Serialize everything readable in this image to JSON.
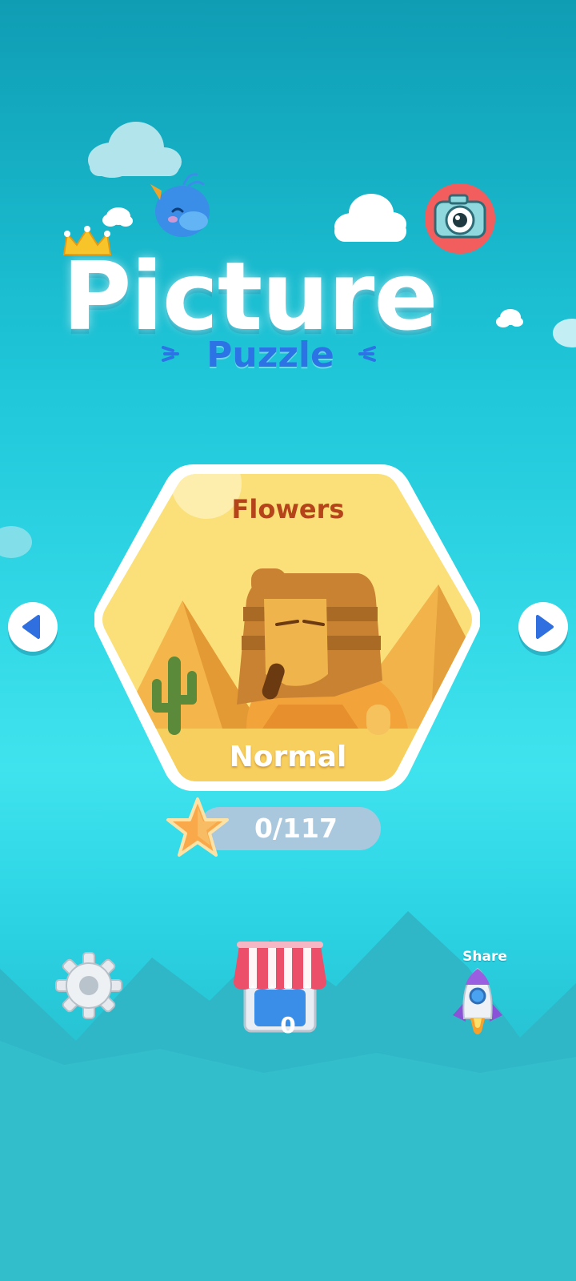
{
  "title": {
    "main": "Picture",
    "sub": "Puzzle"
  },
  "level_card": {
    "category": "Flowers",
    "difficulty": "Normal",
    "artwork": "sphinx-desert-illustration"
  },
  "progress": {
    "text": "0/117",
    "icon": "star-icon"
  },
  "navigation": {
    "prev_icon": "arrow-left-icon",
    "next_icon": "arrow-right-icon"
  },
  "bottom_bar": {
    "settings_icon": "gear-icon",
    "shop_icon": "shop-icon",
    "shop_count": "0",
    "share_label": "Share",
    "share_icon": "rocket-icon"
  },
  "colors": {
    "bg_top": "#0f9db4",
    "bg_mid": "#3fe3ee",
    "title_sub": "#2c73e6",
    "category_text": "#b6441a",
    "card_fill": "#f9d35a",
    "accent_red": "#e8455a"
  }
}
